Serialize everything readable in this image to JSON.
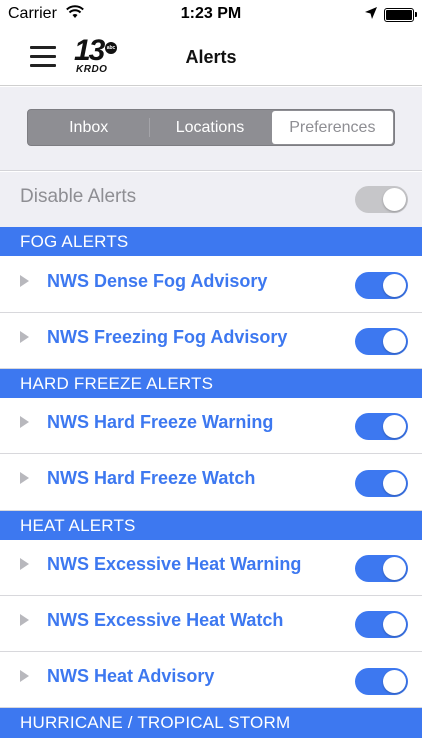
{
  "status_bar": {
    "carrier": "Carrier",
    "time": "1:23 PM"
  },
  "nav": {
    "title": "Alerts",
    "logo_number": "13",
    "logo_network": "abc",
    "logo_call": "KRDO"
  },
  "tabs": [
    {
      "label": "Inbox",
      "selected": false
    },
    {
      "label": "Locations",
      "selected": false
    },
    {
      "label": "Preferences",
      "selected": true
    }
  ],
  "disable_alerts": {
    "label": "Disable Alerts",
    "enabled": false
  },
  "sections": [
    {
      "title": "FOG ALERTS",
      "items": [
        {
          "label": "NWS Dense Fog Advisory",
          "enabled": true
        },
        {
          "label": "NWS Freezing Fog Advisory",
          "enabled": true
        }
      ]
    },
    {
      "title": "HARD FREEZE ALERTS",
      "items": [
        {
          "label": "NWS Hard Freeze Warning",
          "enabled": true
        },
        {
          "label": "NWS Hard Freeze Watch",
          "enabled": true
        }
      ]
    },
    {
      "title": "HEAT ALERTS",
      "items": [
        {
          "label": "NWS Excessive Heat Warning",
          "enabled": true
        },
        {
          "label": "NWS Excessive Heat Watch",
          "enabled": true
        },
        {
          "label": "NWS Heat Advisory",
          "enabled": true
        }
      ]
    },
    {
      "title": "HURRICANE / TROPICAL STORM",
      "items": []
    }
  ],
  "colors": {
    "accent": "#3d78f0",
    "toggle_off": "#c6c6c9",
    "background": "#efeff4"
  }
}
